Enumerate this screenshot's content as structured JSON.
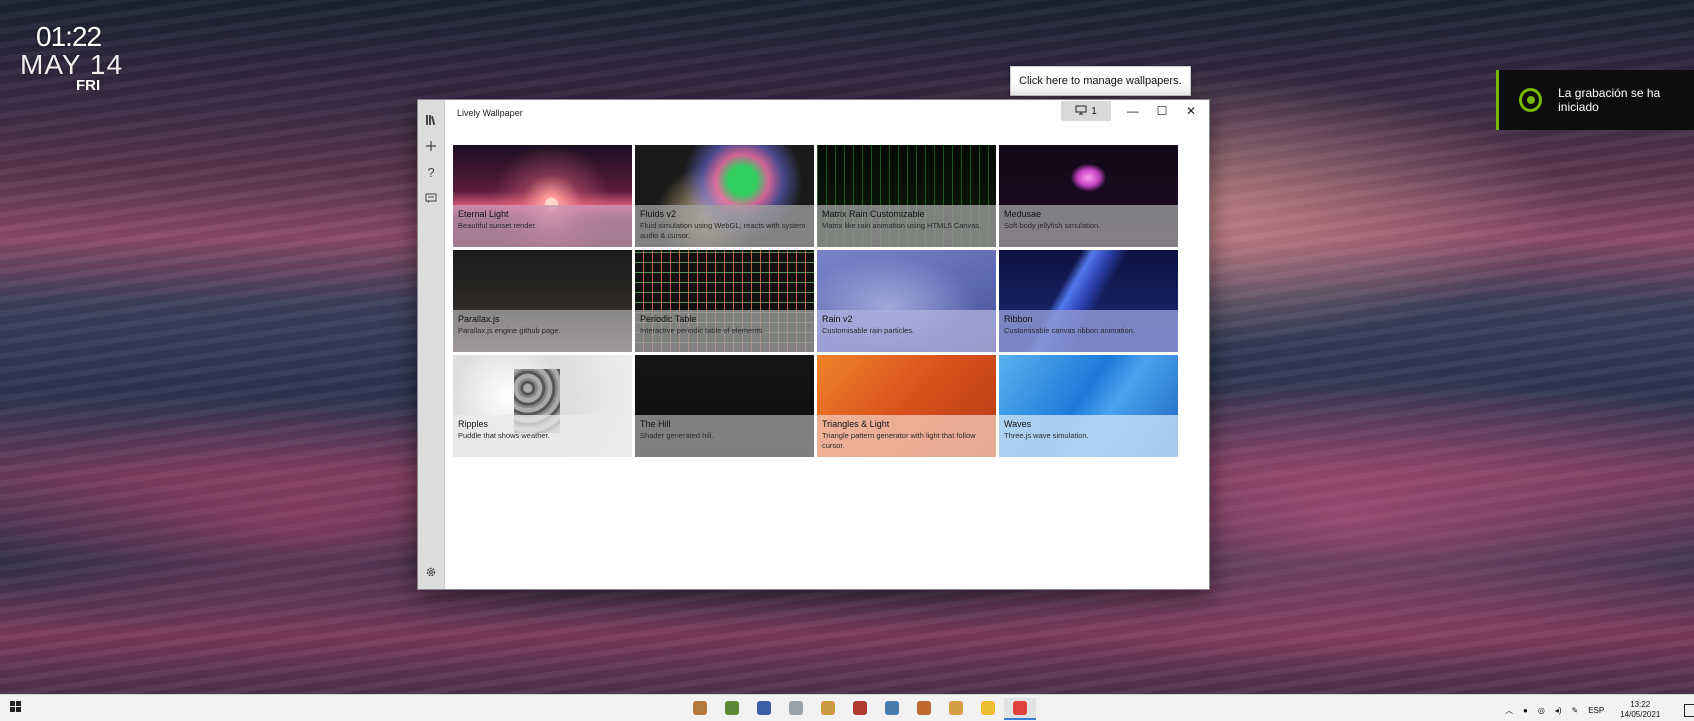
{
  "desktop_clock": {
    "time": "01:22",
    "date": "MAY 14",
    "day": "FRI"
  },
  "recording_notice": {
    "text": "La grabación se ha iniciado",
    "accent": "#76b900"
  },
  "tooltip": {
    "text": "Click here to manage wallpapers."
  },
  "window": {
    "title": "Lively Wallpaper",
    "monitor_button": {
      "icon": "monitor-icon",
      "label": "1"
    },
    "controls": {
      "minimize": "—",
      "maximize": "☐",
      "close": "✕"
    },
    "rail_icons": [
      "library-icon",
      "add-icon",
      "help-icon",
      "feedback-icon",
      "settings-icon"
    ]
  },
  "wallpapers": [
    {
      "name": "Eternal Light",
      "desc": "Beautiful sunset render."
    },
    {
      "name": "Fluids v2",
      "desc": "Fluid simulation using WebGL, reacts with system audio & cursor."
    },
    {
      "name": "Matrix Rain Customizable",
      "desc": "Matrix like rain animation using HTML5 Canvas."
    },
    {
      "name": "Medusae",
      "desc": "Soft body jellyfish simulation."
    },
    {
      "name": "Parallax.js",
      "desc": "Parallax.js engine github page."
    },
    {
      "name": "Periodic Table",
      "desc": "Interactive periodic table of elements."
    },
    {
      "name": "Rain v2",
      "desc": "Customisable rain particles."
    },
    {
      "name": "Ribbon",
      "desc": "Customisable canvas ribbon animation."
    },
    {
      "name": "Ripples",
      "desc": "Puddle that shows weather."
    },
    {
      "name": "The Hill",
      "desc": "Shader generated hill."
    },
    {
      "name": "Triangles & Light",
      "desc": "Triangle pattern generator with light that follow cursor."
    },
    {
      "name": "Waves",
      "desc": "Three.js wave simulation."
    }
  ],
  "taskbar": {
    "apps": [
      {
        "name": "archive-app-icon",
        "color": "#b07a3a"
      },
      {
        "name": "minecraft-app-icon",
        "color": "#5a8a3a"
      },
      {
        "name": "app-icon-blue",
        "color": "#3a5fa8"
      },
      {
        "name": "chat-app-icon",
        "color": "#9aa0a8"
      },
      {
        "name": "app-icon-tools",
        "color": "#c89a40"
      },
      {
        "name": "app-icon-red",
        "color": "#b03a30"
      },
      {
        "name": "app-icon-robot",
        "color": "#4a7aa8"
      },
      {
        "name": "app-icon-brush",
        "color": "#c06a30"
      },
      {
        "name": "app-icon-notes",
        "color": "#d0a040"
      },
      {
        "name": "emoji-app-icon",
        "color": "#e8c030"
      },
      {
        "name": "lively-app-icon",
        "color": "#e04040"
      }
    ],
    "language": "ESP",
    "clock_time": "13:22",
    "clock_date": "14/05/2021"
  }
}
